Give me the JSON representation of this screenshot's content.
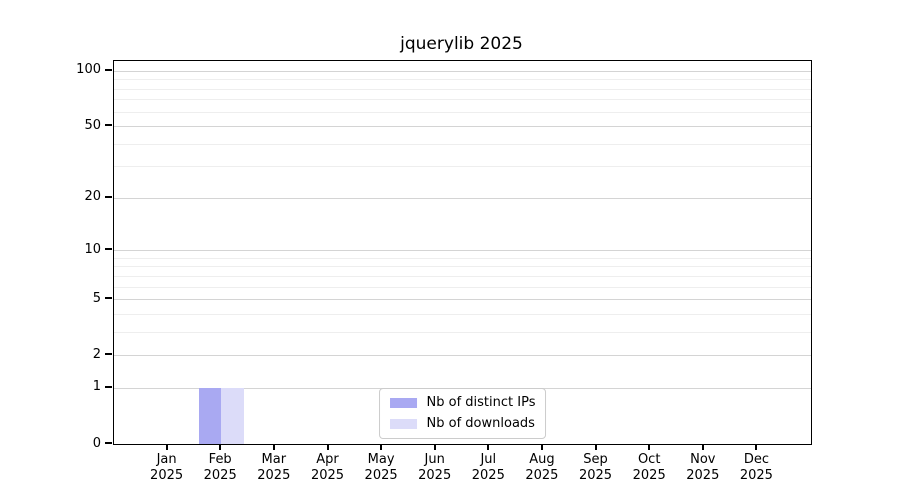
{
  "title": "jquerylib 2025",
  "chart_data": {
    "type": "bar",
    "title": "jquerylib 2025",
    "x_months": [
      "Jan",
      "Feb",
      "Mar",
      "Apr",
      "May",
      "Jun",
      "Jul",
      "Aug",
      "Sep",
      "Oct",
      "Nov",
      "Dec"
    ],
    "x_year": "2025",
    "series": [
      {
        "name": "Nb of distinct IPs",
        "color": "#a9a9f2",
        "values": [
          0,
          1,
          0,
          0,
          0,
          0,
          0,
          0,
          0,
          0,
          0,
          0
        ]
      },
      {
        "name": "Nb of downloads",
        "color": "#dcdcf9",
        "values": [
          0,
          1,
          0,
          0,
          0,
          0,
          0,
          0,
          0,
          0,
          0,
          0
        ]
      }
    ],
    "yscale": "log1p",
    "ylim": [
      0,
      113
    ],
    "y_major_ticks": [
      0,
      1,
      2,
      5,
      10,
      20,
      50,
      100
    ],
    "y_minor_ticks": [
      3,
      4,
      6,
      7,
      8,
      9,
      30,
      40,
      60,
      70,
      80,
      90
    ],
    "grid": true,
    "legend_position": "lower center"
  },
  "colors": {
    "bar_distinct_ips": "#a9a9f2",
    "bar_downloads": "#dcdcf9",
    "grid_major": "#d4d4d4",
    "grid_minor": "#eeeeee",
    "legend_border": "#cccccc",
    "axis": "#000000"
  }
}
